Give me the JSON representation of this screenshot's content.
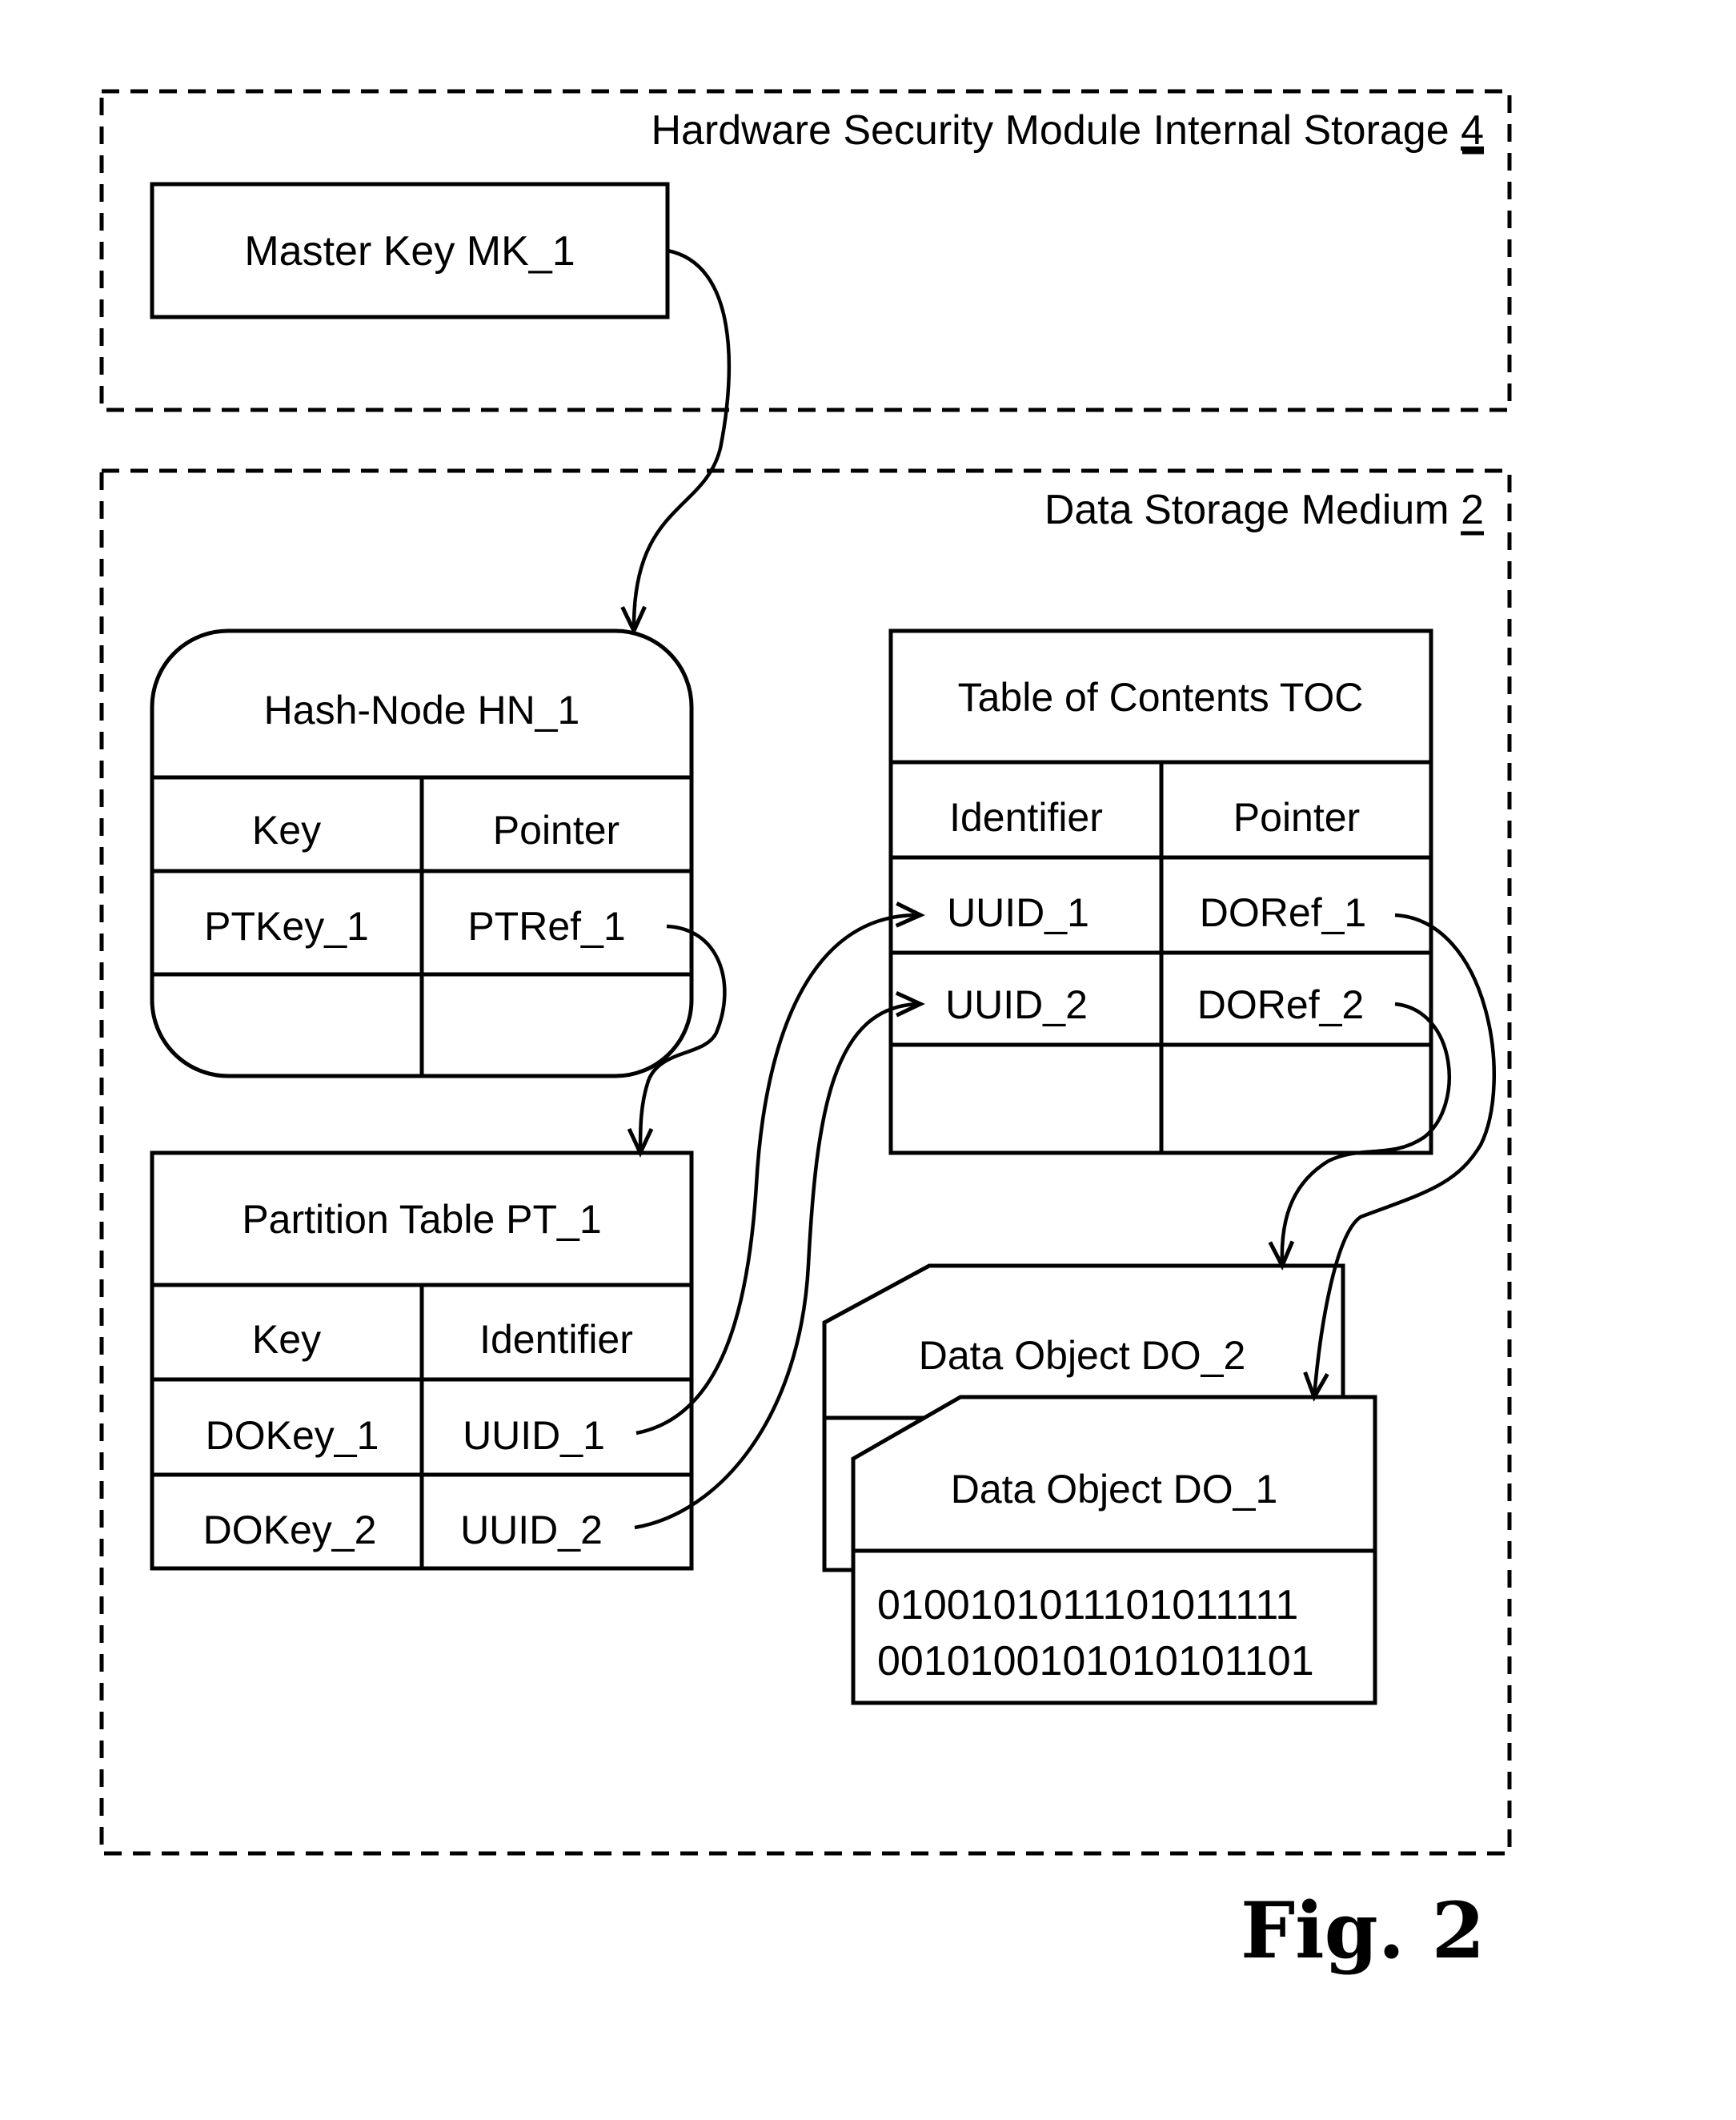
{
  "figure_label": "Fig. 2",
  "hsm_storage": {
    "label": "Hardware Security Module Internal Storage",
    "ref": "4",
    "master_key": "Master Key MK_1"
  },
  "data_storage": {
    "label": "Data Storage Medium",
    "ref": "2"
  },
  "hash_node": {
    "title": "Hash-Node HN_1",
    "headers": [
      "Key",
      "Pointer"
    ],
    "rows": [
      [
        "PTKey_1",
        "PTRef_1"
      ],
      [
        "",
        ""
      ]
    ]
  },
  "partition_table": {
    "title": "Partition Table PT_1",
    "headers": [
      "Key",
      "Identifier"
    ],
    "rows": [
      [
        "DOKey_1",
        "UUID_1"
      ],
      [
        "DOKey_2",
        "UUID_2"
      ]
    ]
  },
  "toc": {
    "title": "Table of Contents TOC",
    "headers": [
      "Identifier",
      "Pointer"
    ],
    "rows": [
      [
        "UUID_1",
        "DORef_1"
      ],
      [
        "UUID_2",
        "DORef_2"
      ],
      [
        "",
        ""
      ]
    ]
  },
  "data_object_2": {
    "title": "Data Object DO_2"
  },
  "data_object_1": {
    "title": "Data Object DO_1",
    "content": [
      "0100101011101011111",
      "0010100101010101101"
    ]
  },
  "connections": [
    {
      "from": "Master Key MK_1",
      "to": "Hash-Node HN_1"
    },
    {
      "from": "PTRef_1",
      "to": "Partition Table PT_1"
    },
    {
      "from": "UUID_1 (PT_1)",
      "to": "UUID_1 (TOC)"
    },
    {
      "from": "UUID_2 (PT_1)",
      "to": "UUID_2 (TOC)"
    },
    {
      "from": "DORef_1",
      "to": "Data Object DO_1"
    },
    {
      "from": "DORef_2",
      "to": "Data Object DO_2"
    }
  ]
}
